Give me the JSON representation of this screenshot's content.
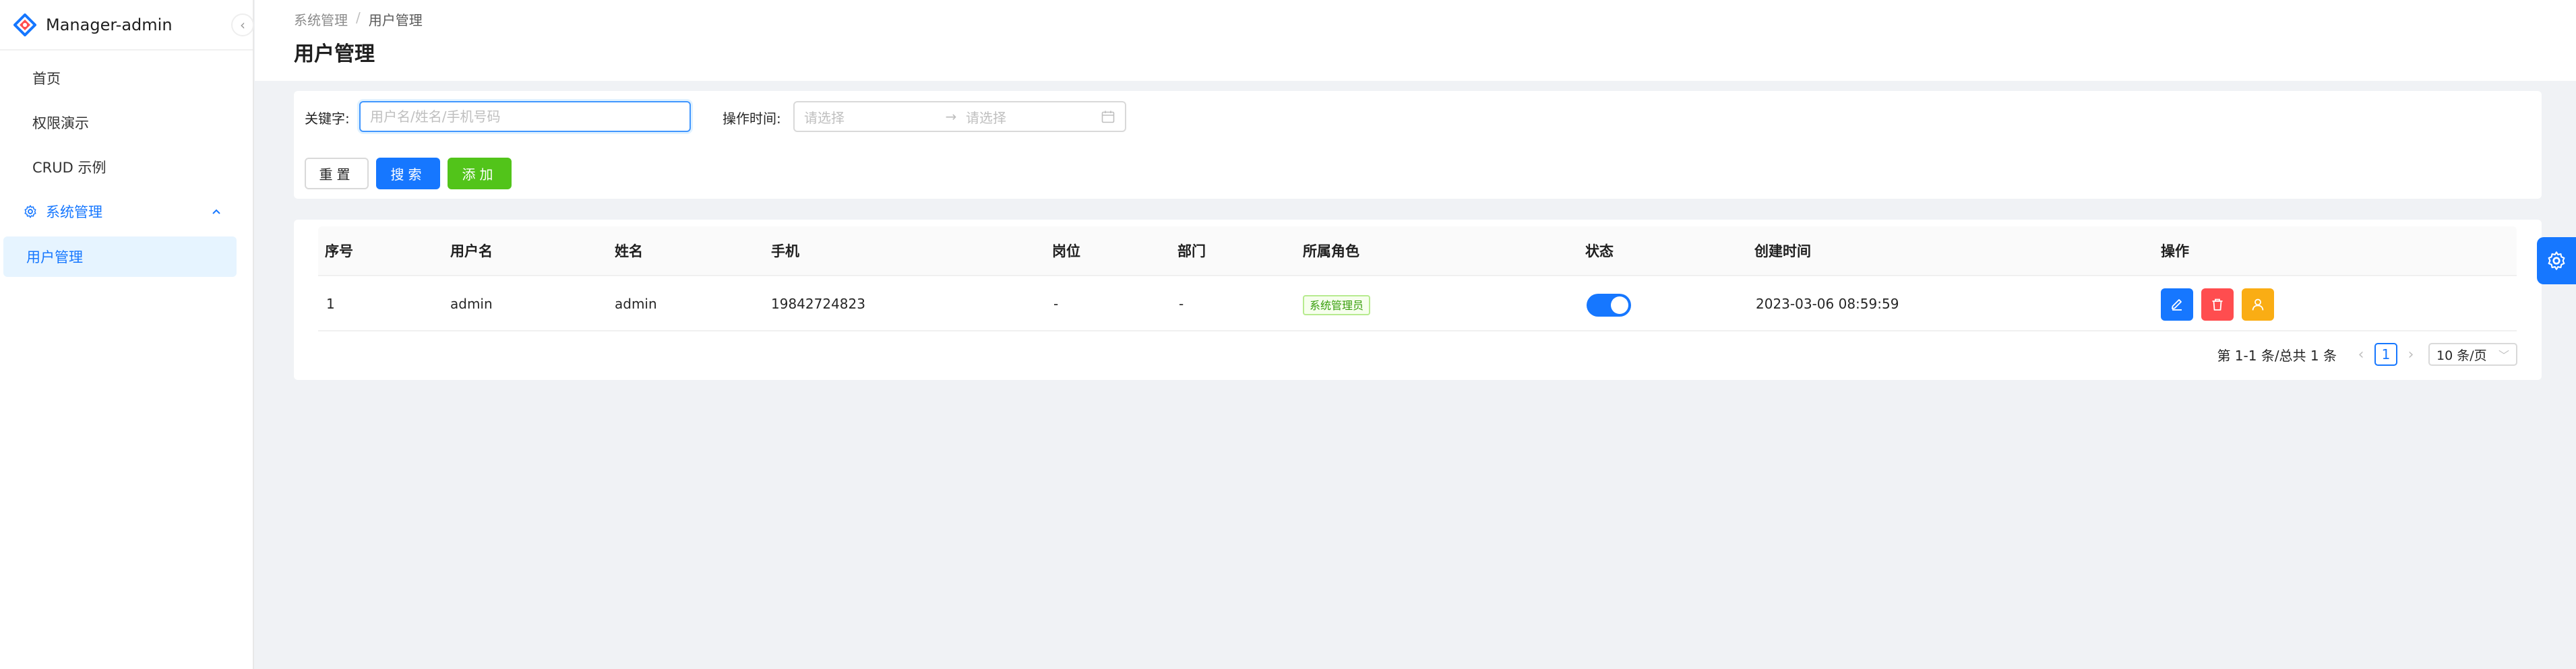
{
  "app": {
    "title": "Manager-admin"
  },
  "sidebar": {
    "items": [
      {
        "label": "首页"
      },
      {
        "label": "权限演示"
      },
      {
        "label": "CRUD 示例"
      }
    ],
    "group": {
      "label": "系统管理",
      "icon": "gear-icon",
      "expanded": true
    },
    "sub_items": [
      {
        "label": "用户管理",
        "active": true
      }
    ]
  },
  "header": {
    "breadcrumb": [
      "系统管理",
      "/",
      "用户管理"
    ],
    "title": "用户管理"
  },
  "search": {
    "keyword_label": "关键字:",
    "keyword_placeholder": "用户名/姓名/手机号码",
    "keyword_value": "",
    "time_label": "操作时间:",
    "start_placeholder": "请选择",
    "range_arrow": "→",
    "end_placeholder": "请选择",
    "reset_label": "重置",
    "search_label": "搜索",
    "add_label": "添加"
  },
  "table": {
    "columns": [
      "序号",
      "用户名",
      "姓名",
      "手机",
      "岗位",
      "部门",
      "所属角色",
      "状态",
      "创建时间",
      "操作"
    ],
    "rows": [
      {
        "index": "1",
        "username": "admin",
        "name": "admin",
        "phone": "19842724823",
        "post": "-",
        "dept": "-",
        "role": "系统管理员",
        "status_on": true,
        "created": "2023-03-06 08:59:59"
      }
    ]
  },
  "pagination": {
    "total_text": "第 1-1 条/总共 1 条",
    "prev": "‹",
    "current_page": "1",
    "next": "›",
    "page_size": "10 条/页"
  },
  "colors": {
    "primary": "#1677ff",
    "success": "#52c41a",
    "danger": "#ff4d4f",
    "warning": "#faad14"
  }
}
